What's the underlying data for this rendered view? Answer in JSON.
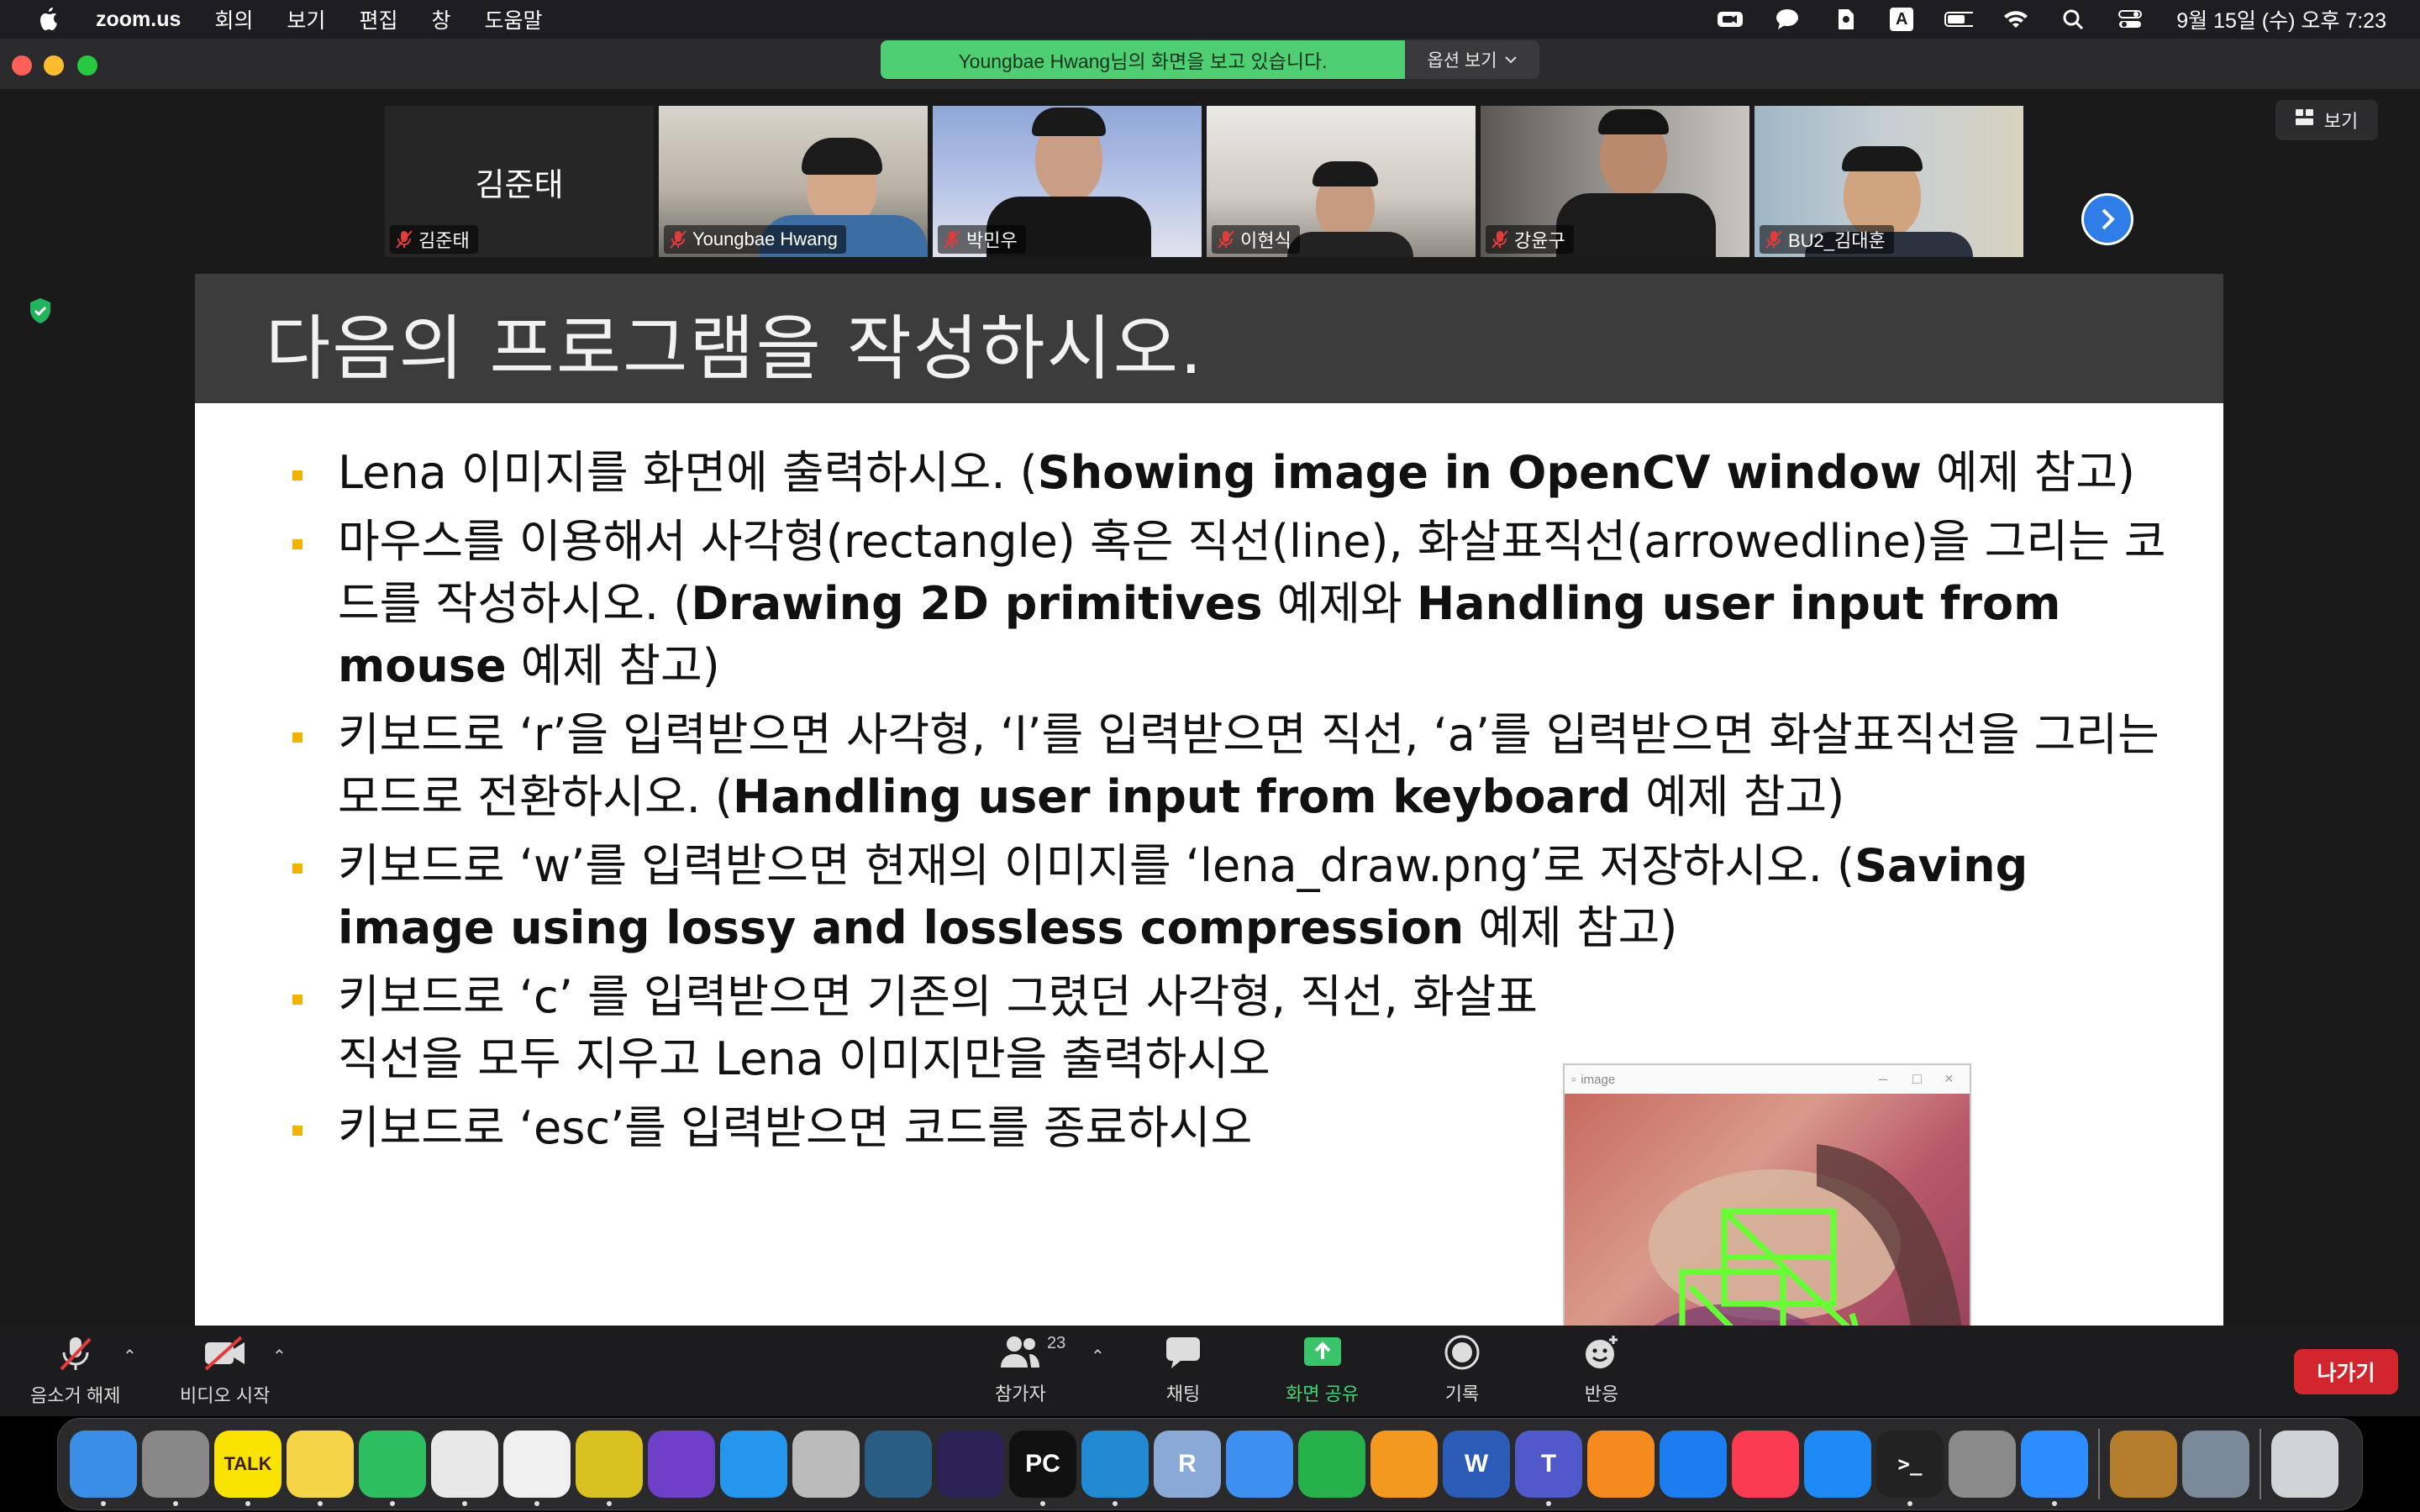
{
  "menubar": {
    "app_name": "zoom.us",
    "menus": [
      "회의",
      "보기",
      "편집",
      "창",
      "도움말"
    ],
    "datetime": "9월 15일 (수) 오후 7:23",
    "input_source": "A"
  },
  "zoom": {
    "share_banner": "Youngbae Hwang님의 화면을 보고 있습니다.",
    "view_options_label": "옵션 보기",
    "view_button_label": "보기",
    "participants": [
      {
        "name": "김준태",
        "big_name": "김준태",
        "video": false,
        "active": false
      },
      {
        "name": "Youngbae Hwang",
        "video": true,
        "active": false
      },
      {
        "name": "박민우",
        "video": true,
        "active": true
      },
      {
        "name": "이현식",
        "video": true,
        "active": false
      },
      {
        "name": "강윤구",
        "video": true,
        "active": false
      },
      {
        "name": "BU2_김대훈",
        "video": true,
        "active": false
      }
    ],
    "toolbar": {
      "unmute": "음소거 해제",
      "start_video": "비디오 시작",
      "participants": "참가자",
      "participants_count": "23",
      "chat": "채팅",
      "share_screen": "화면 공유",
      "record": "기록",
      "reactions": "반응",
      "leave": "나가기"
    },
    "accent_green": "#4fcf73",
    "leave_red": "#d1262e"
  },
  "slide": {
    "title": "다음의 프로그램을 작성하시오.",
    "bullets": [
      {
        "text": "Lena 이미지를 화면에 출력하시오. (",
        "bold": "Showing image in OpenCV window",
        "tail": " 예제 참고)"
      },
      {
        "text": "마우스를 이용해서 사각형(rectangle) 혹은 직선(line), 화살표직선(arrowedline)을 그리는 코드를 작성하시오. (",
        "bold": "Drawing 2D primitives",
        "mid": " 예제와 ",
        "bold2": "Handling user input from mouse",
        "tail": " 예제 참고)"
      },
      {
        "text": "키보드로 ‘r’을 입력받으면 사각형, ‘l’를 입력받으면 직선, ‘a’를 입력받으면 화살표직선을 그리는 모드로 전환하시오. (",
        "bold": "Handling user input from keyboard",
        "tail": " 예제 참고)"
      },
      {
        "text": "키보드로 ‘w’를 입력받으면 현재의 이미지를 ‘lena_draw.png’로 저장하시오. (",
        "bold": "Saving image using lossy and lossless compression",
        "tail": " 예제 참고)"
      },
      {
        "text": "키보드로 ‘c’ 를 입력받으면 기존의 그렸던 사각형, 직선, 화살표직선을 모두 지우고 Lena 이미지만을 출력하시오"
      },
      {
        "text": "키보드로 ‘esc’를 입력받으면 코드를 종료하시오"
      }
    ],
    "thumbnail_window_title": "image"
  },
  "dock": {
    "apps": [
      {
        "name": "Finder",
        "glyph": "",
        "color": "#3a8ee6"
      },
      {
        "name": "Launchpad",
        "glyph": "",
        "color": "#888"
      },
      {
        "name": "KakaoTalk",
        "glyph": "TALK",
        "color": "#fbe300"
      },
      {
        "name": "Notes",
        "glyph": "",
        "color": "#f5d547"
      },
      {
        "name": "Evernote",
        "glyph": "",
        "color": "#2dbe60"
      },
      {
        "name": "Chrome",
        "glyph": "",
        "color": "#e8e8e8"
      },
      {
        "name": "Photos",
        "glyph": "",
        "color": "#f0f0f0"
      },
      {
        "name": "Beta App",
        "glyph": "",
        "color": "#d9c21f"
      },
      {
        "name": "GitHub Desktop",
        "glyph": "",
        "color": "#6e40c9"
      },
      {
        "name": "Docker",
        "glyph": "",
        "color": "#2496ed"
      },
      {
        "name": "Database",
        "glyph": "",
        "color": "#bbb"
      },
      {
        "name": "MySQL Workbench",
        "glyph": "",
        "color": "#2a5d84"
      },
      {
        "name": "Eclipse",
        "glyph": "",
        "color": "#2c2255"
      },
      {
        "name": "PyCharm",
        "glyph": "PC",
        "color": "#111"
      },
      {
        "name": "VS Code",
        "glyph": "",
        "color": "#1f8ad2"
      },
      {
        "name": "R",
        "glyph": "R",
        "color": "#8aa9d6"
      },
      {
        "name": "Keynote",
        "glyph": "",
        "color": "#3d8ff2"
      },
      {
        "name": "Numbers",
        "glyph": "",
        "color": "#27b14b"
      },
      {
        "name": "Pages",
        "glyph": "",
        "color": "#f39a1e"
      },
      {
        "name": "Word",
        "glyph": "W",
        "color": "#2b5cb8"
      },
      {
        "name": "Teams",
        "glyph": "T",
        "color": "#5059c9"
      },
      {
        "name": "GarageBand",
        "glyph": "",
        "color": "#f58a1f"
      },
      {
        "name": "Xcode",
        "glyph": "",
        "color": "#1c7df0"
      },
      {
        "name": "Music",
        "glyph": "",
        "color": "#fa3b51"
      },
      {
        "name": "App Store",
        "glyph": "",
        "color": "#1d8af5"
      },
      {
        "name": "Terminal",
        "glyph": ">_",
        "color": "#222"
      },
      {
        "name": "System Preferences",
        "glyph": "",
        "color": "#8a8a8a"
      },
      {
        "name": "Zoom",
        "glyph": "",
        "color": "#2d8cff"
      },
      {
        "name": "Hearthstone",
        "glyph": "",
        "color": "#b37d2b"
      },
      {
        "name": "Preview",
        "glyph": "",
        "color": "#7a8a9a"
      },
      {
        "name": "Trash",
        "glyph": "",
        "color": "#cfd4d8"
      }
    ]
  }
}
